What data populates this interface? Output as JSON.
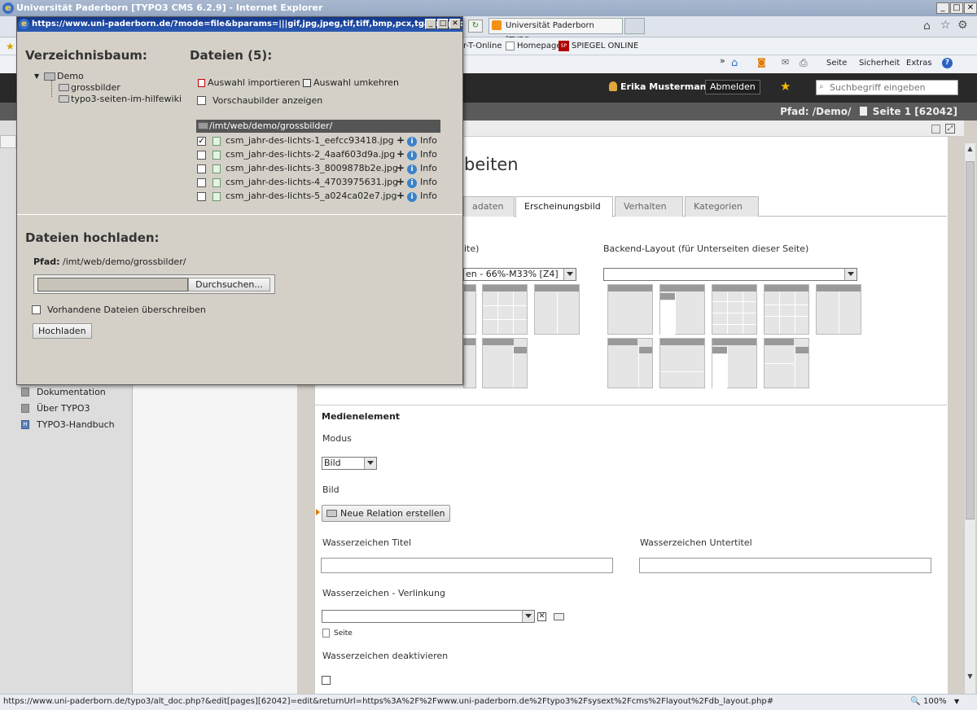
{
  "browser": {
    "window_title": "Universität Paderborn [TYPO3 CMS 6.2.9] - Internet Explorer",
    "tab_title": "Universität Paderborn [TYPO...",
    "favorites": [
      "r-T-Online",
      "Homepage",
      "SPIEGEL ONLINE"
    ],
    "commands": [
      "Seite",
      "Sicherheit",
      "Extras"
    ],
    "status_url": "https://www.uni-paderborn.de/typo3/alt_doc.php?&edit[pages][62042]=edit&returnUrl=https%3A%2F%2Fwww.uni-paderborn.de%2Ftypo3%2Fsysext%2Fcms%2Flayout%2Fdb_layout.php#",
    "zoom": "100%"
  },
  "typo3": {
    "user": "Erika Mustermann",
    "logout": "Abmelden",
    "search_placeholder": "Suchbegriff eingeben",
    "path_label": "Pfad:",
    "path_value": "/Demo/",
    "page_label": "Seite 1 [62042]"
  },
  "left_menu": {
    "items": [
      "Dokumentation",
      "Über TYPO3",
      "TYPO3-Handbuch"
    ]
  },
  "main": {
    "heading_partial": "beiten",
    "tabs": [
      "adaten",
      "Erscheinungsbild",
      "Verhalten",
      "Kategorien"
    ],
    "frontend_layout_label_partial": "ite)",
    "frontend_layout_value_partial": "en - 66%-M33% [Z4]",
    "backend_layout_label": "Backend-Layout (für Unterseiten dieser Seite)",
    "section_title": "Medienelement",
    "modus_label": "Modus",
    "modus_value": "Bild",
    "bild_label": "Bild",
    "new_relation": "Neue Relation erstellen",
    "wz_title_label": "Wasserzeichen Titel",
    "wz_subtitle_label": "Wasserzeichen Untertitel",
    "wz_link_label": "Wasserzeichen - Verlinkung",
    "wz_page_link": "Seite",
    "wz_disable_label": "Wasserzeichen deaktivieren"
  },
  "popup": {
    "url": "https://www.uni-paderborn.de/?mode=file&bparams=|||gif,jpg,jpeg,tif,tiff,bmp,pcx,tga,png,pdf,a...",
    "tree_title": "Verzeichnisbaum:",
    "tree_root": "Demo",
    "tree_children": [
      "grossbilder",
      "typo3-seiten-im-hilfewiki"
    ],
    "files_title": "Dateien (5):",
    "import_selection": "Auswahl importieren",
    "invert_selection": "Auswahl umkehren",
    "show_thumbs": "Vorschaubilder anzeigen",
    "folder_path": "/imt/web/demo/grossbilder/",
    "files": [
      {
        "name": "csm_jahr-des-lichts-1_eefcc93418.jpg",
        "checked": true
      },
      {
        "name": "csm_jahr-des-lichts-2_4aaf603d9a.jpg",
        "checked": false
      },
      {
        "name": "csm_jahr-des-lichts-3_8009878b2e.jpg",
        "checked": false
      },
      {
        "name": "csm_jahr-des-lichts-4_4703975631.jpg",
        "checked": false
      },
      {
        "name": "csm_jahr-des-lichts-5_a024ca02e7.jpg",
        "checked": false
      }
    ],
    "info_label": "Info",
    "plus": "+",
    "upload_title": "Dateien hochladen:",
    "upload_path_label": "Pfad:",
    "upload_path_value": "/imt/web/demo/grossbilder/",
    "browse_button": "Durchsuchen...",
    "overwrite_label": "Vorhandene Dateien überschreiben",
    "upload_button": "Hochladen"
  }
}
